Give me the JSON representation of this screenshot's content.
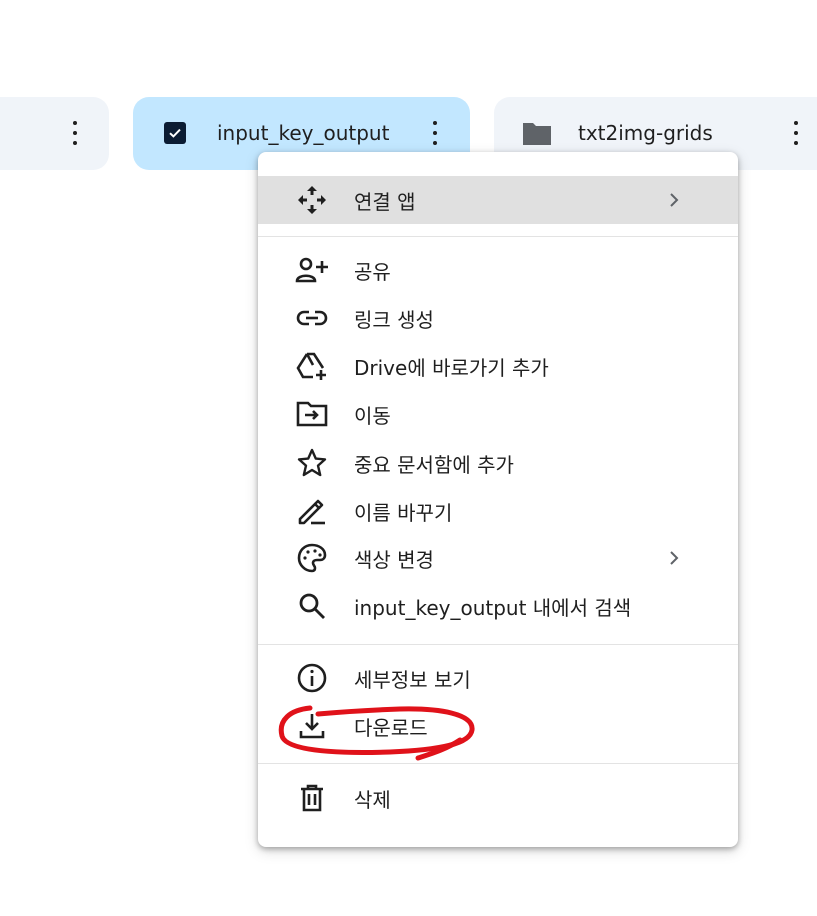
{
  "cards": [
    {
      "label": ""
    },
    {
      "label": "input_key_output",
      "selected": true
    },
    {
      "label": "txt2img-grids"
    }
  ],
  "menu": {
    "items": [
      {
        "label": "연결 앱",
        "icon": "open-with-icon",
        "has_submenu": true
      },
      {
        "label": "공유",
        "icon": "person-add-icon"
      },
      {
        "label": "링크 생성",
        "icon": "link-icon"
      },
      {
        "label": "Drive에 바로가기 추가",
        "icon": "drive-shortcut-add-icon"
      },
      {
        "label": "이동",
        "icon": "folder-move-icon"
      },
      {
        "label": "중요 문서함에 추가",
        "icon": "star-icon"
      },
      {
        "label": "이름 바꾸기",
        "icon": "edit-icon"
      },
      {
        "label": "색상 변경",
        "icon": "palette-icon",
        "has_submenu": true
      },
      {
        "label": "input_key_output 내에서 검색",
        "icon": "search-icon"
      },
      {
        "label": "세부정보 보기",
        "icon": "info-icon"
      },
      {
        "label": "다운로드",
        "icon": "download-icon"
      },
      {
        "label": "삭제",
        "icon": "trash-icon"
      }
    ]
  },
  "colors": {
    "selected_card": "#c2e7ff",
    "card": "#f0f4f9",
    "hover": "#e0e0e0",
    "annotation": "#e0121a"
  }
}
